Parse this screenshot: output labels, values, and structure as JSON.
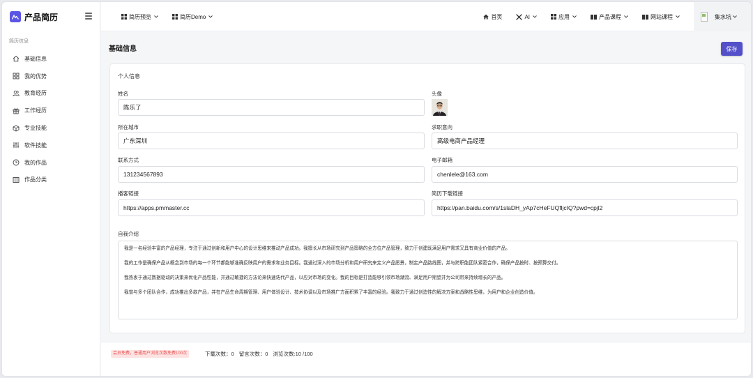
{
  "brand": {
    "name": "产品简历",
    "accent": "#5b55e6"
  },
  "sidebar": {
    "group_title": "简历信息",
    "items": [
      {
        "label": "基础信息",
        "icon": "home-icon"
      },
      {
        "label": "我的优势",
        "icon": "grid-icon"
      },
      {
        "label": "教育经历",
        "icon": "users-icon"
      },
      {
        "label": "工作经历",
        "icon": "gift-icon"
      },
      {
        "label": "专业技能",
        "icon": "cube-icon"
      },
      {
        "label": "软件技能",
        "icon": "sliders-icon"
      },
      {
        "label": "我的作品",
        "icon": "clock-icon"
      },
      {
        "label": "作品分类",
        "icon": "columns-icon"
      }
    ]
  },
  "topbar": {
    "left": [
      {
        "label": "简历预览",
        "icon": "grid-icon"
      },
      {
        "label": "简历Demo",
        "icon": "grid-icon"
      }
    ],
    "right": [
      {
        "label": "首页",
        "icon": "home-icon"
      },
      {
        "label": "AI",
        "icon": "tools-icon"
      },
      {
        "label": "应用",
        "icon": "grid-icon"
      },
      {
        "label": "产品课程",
        "icon": "book-icon"
      },
      {
        "label": "网站课程",
        "icon": "book-icon"
      }
    ],
    "user": {
      "name": "集水坑"
    }
  },
  "page": {
    "title": "基础信息",
    "save_label": "保存",
    "save_color": "#5350c9"
  },
  "form": {
    "section_title": "个人信息",
    "name": {
      "label": "姓名",
      "value": "陈乐了"
    },
    "avatar": {
      "label": "头像"
    },
    "city": {
      "label": "所在城市",
      "value": "广东深圳"
    },
    "job_intent": {
      "label": "求职意向",
      "value": "高级电商产品经理"
    },
    "phone": {
      "label": "联系方式",
      "value": "131234567893"
    },
    "email": {
      "label": "电子邮箱",
      "value": "chenlele@163.com"
    },
    "blog": {
      "label": "播客链接",
      "value": "https://apps.pmmaster.cc"
    },
    "resume_link": {
      "label": "简历下载链接",
      "value": "https://pan.baidu.com/s/1slaDH_yAp7cHeFUQfljcIQ?pwd=cpjl2"
    },
    "intro": {
      "label": "自我介绍",
      "paragraphs": [
        "我是一名经验丰富的产品经理，专注于通过创新和用户中心的设计思维来推动产品成功。我擅长从市场研究到产品策略的全方位产品管理，致力于创建既满足用户需求又具有商业价值的产品。",
        "我的工作是确保产品从概念到市场的每一个环节都能够准确反映用户的需求和业务目标。我通过深入的市场分析和用户研究来定义产品愿景，制定产品路线图，并与跨职能团队紧密合作，确保产品按时、按预算交付。",
        "我热衷于通过数据驱动的决策来优化产品性能，并通过敏捷的方法论来快速迭代产品，以应对市场的变化。我的目标是打造能够引领市场潮流、满足用户期望并为公司带来持续增长的产品。",
        "我曾与多个团队合作，成功推出多款产品，并在产品生命周期管理、用户体验设计、技术协调以及市场推广方面积累了丰富的经验。我致力于通过创造性的解决方案和战略性思维，为用户和企业创造价值。"
      ]
    }
  },
  "footer": {
    "vip_notice": "会员免费，普通用户浏览次数免费100次",
    "downloads": "下载次数：0",
    "messages": "留言次数：0",
    "views": "浏览次数:10 /100"
  }
}
